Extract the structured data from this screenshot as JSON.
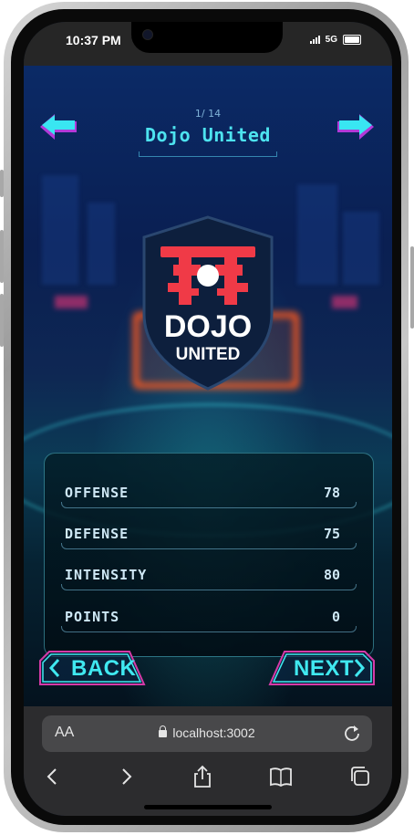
{
  "status_bar": {
    "time": "10:37 PM",
    "network": "5G"
  },
  "header": {
    "counter": "1/ 14",
    "team_name": "Dojo United",
    "prev_icon": "arrow-left-icon",
    "next_icon": "arrow-right-icon"
  },
  "crest": {
    "line1": "DOJO",
    "line2": "UNITED",
    "accent": "#f03a47",
    "shield": "#0d1f3d"
  },
  "stats": [
    {
      "label": "OFFENSE",
      "value": "78"
    },
    {
      "label": "DEFENSE",
      "value": "75"
    },
    {
      "label": "INTENSITY",
      "value": "80"
    },
    {
      "label": "POINTS",
      "value": "0"
    }
  ],
  "nav": {
    "back_label": "BACK",
    "next_label": "NEXT"
  },
  "browser": {
    "aa_label": "AA",
    "url": "localhost:3002",
    "toolbar": [
      "back-icon",
      "forward-icon",
      "share-icon",
      "bookmarks-icon",
      "tabs-icon"
    ]
  },
  "colors": {
    "cyan": "#40e8f0",
    "magenta": "#d63aa8",
    "panel_border": "#50bed2"
  }
}
